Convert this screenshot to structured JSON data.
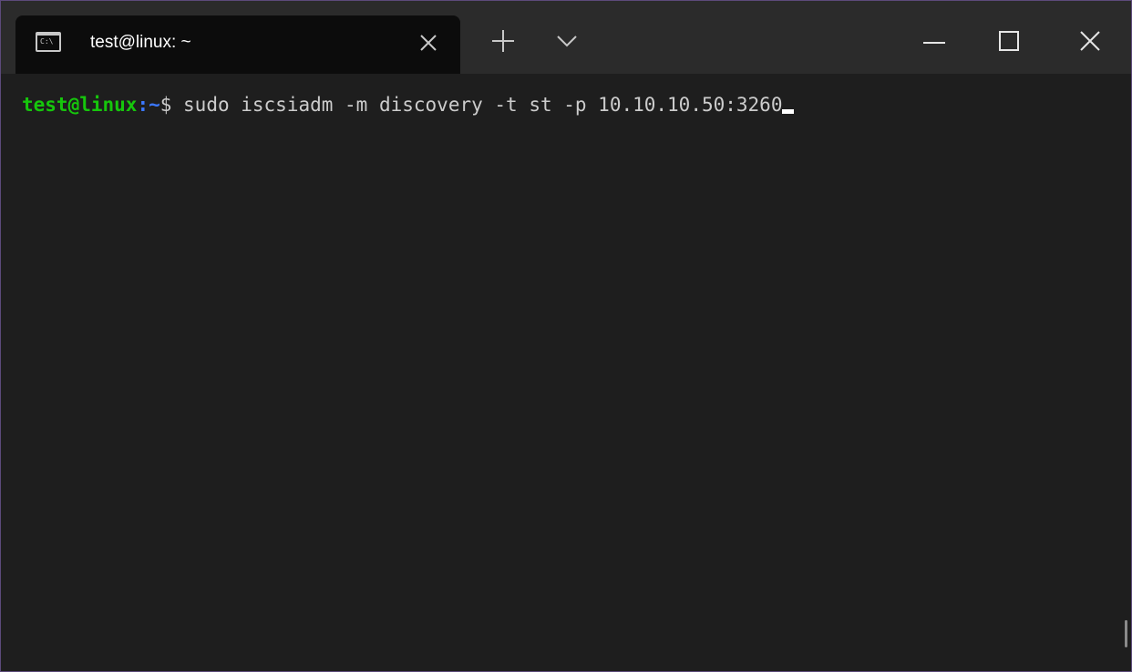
{
  "tab": {
    "title": "test@linux: ~",
    "icon": "console-icon",
    "icon_glyph": "C:\\"
  },
  "titlebar": {
    "new_tab_icon": "plus-icon",
    "dropdown_icon": "chevron-down-icon",
    "minimize_icon": "minimize-icon",
    "maximize_icon": "maximize-icon",
    "close_icon": "close-icon"
  },
  "terminal": {
    "prompt_user": "test@linux",
    "prompt_path": ":~",
    "prompt_symbol": "$",
    "command": " sudo iscsiadm -m discovery -t st -p 10.10.10.50:3260"
  },
  "colors": {
    "background": "#1e1e1e",
    "titlebar": "#2b2b2b",
    "active_tab": "#0c0c0c",
    "prompt_user": "#16c60c",
    "prompt_path": "#3b78ff",
    "text": "#cccccc"
  }
}
